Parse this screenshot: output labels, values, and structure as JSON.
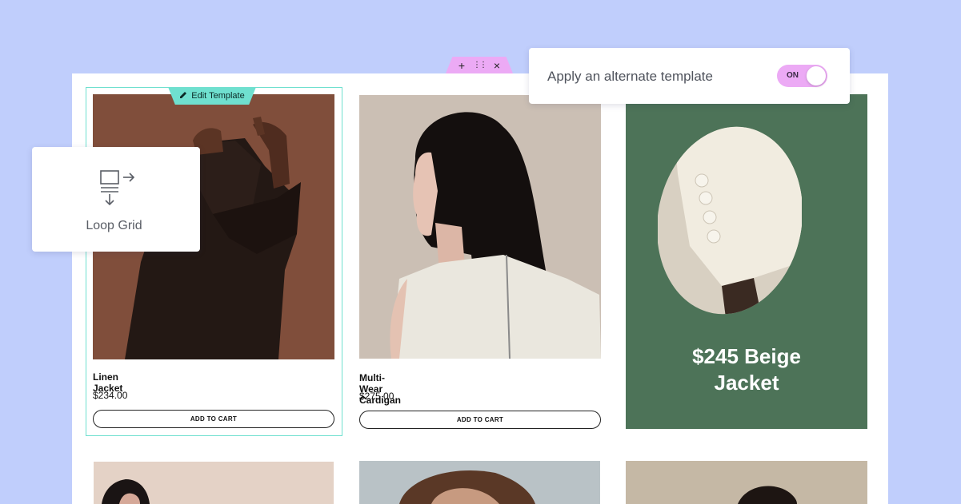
{
  "handle_bar": {
    "add_symbol": "+",
    "drag_symbol": "⋮⋮",
    "close_symbol": "×"
  },
  "alternate_template_panel": {
    "label": "Apply an alternate template",
    "toggle_text": "ON",
    "toggle_on": true
  },
  "widget_panel": {
    "label": "Loop Grid",
    "icon": "loop-grid-icon"
  },
  "edit_template": {
    "label": "Edit Template",
    "icon": "pencil-icon"
  },
  "products": [
    {
      "title": "Linen Jacket",
      "price": "$234.00",
      "button": "ADD TO CART"
    },
    {
      "title": "Multi-Wear Cardigan",
      "price": "$275.00",
      "button": "ADD TO CART"
    }
  ],
  "promo": {
    "line1": "$245 Beige",
    "line2": "Jacket"
  },
  "colors": {
    "background": "#c0cefc",
    "selection": "#6fe0cf",
    "accent_pink": "#ecaaf5",
    "promo_green": "#4d7358"
  }
}
